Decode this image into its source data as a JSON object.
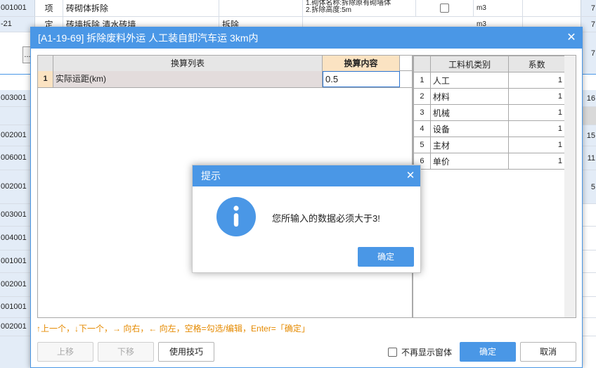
{
  "background": {
    "rows": [
      {
        "code": "001001",
        "type": "项",
        "name": "砖砌体拆除",
        "feature": "1.砌体名称:拆除原有砌墙体\n2.拆除高度:5m",
        "unit": "m3",
        "num": "7"
      },
      {
        "code": "-21",
        "type": "定",
        "name": "砖墙拆除 清水砖墙",
        "category": "拆除",
        "unit": "m3",
        "num": "7"
      },
      {
        "code": "",
        "num": "7"
      },
      {
        "code": "003001",
        "num": "16"
      },
      {
        "code": "002001",
        "num": "15"
      },
      {
        "code": "006001",
        "num": "11"
      },
      {
        "code": "002001",
        "num": "5"
      },
      {
        "code": "003001",
        "num": ""
      },
      {
        "code": "004001",
        "num": ""
      },
      {
        "code": "001001",
        "num": ""
      },
      {
        "code": "002001",
        "num": ""
      },
      {
        "code": "001001",
        "num": ""
      },
      {
        "code": "002001",
        "num": ""
      }
    ],
    "dots_label": "..."
  },
  "dialog": {
    "title": "[A1-19-69] 拆除废料外运 人工装自卸汽车运 3km内",
    "close_glyph": "✕",
    "left_table": {
      "col_list": "换算列表",
      "col_content": "换算内容",
      "rows": [
        {
          "num": "1",
          "name": "实际运距(km)",
          "value": "0.5"
        }
      ]
    },
    "right_table": {
      "col_type": "工料机类别",
      "col_coef": "系数",
      "rows": [
        {
          "num": "1",
          "type": "人工",
          "coef": "1"
        },
        {
          "num": "2",
          "type": "材料",
          "coef": "1"
        },
        {
          "num": "3",
          "type": "机械",
          "coef": "1"
        },
        {
          "num": "4",
          "type": "设备",
          "coef": "1"
        },
        {
          "num": "5",
          "type": "主材",
          "coef": "1"
        },
        {
          "num": "6",
          "type": "单价",
          "coef": "1"
        }
      ]
    },
    "hint": "↑上一个，↓下一个，→ 向右，← 向左，空格=勾选/编辑，Enter=「确定」",
    "buttons": {
      "up": "上移",
      "down": "下移",
      "tips": "使用技巧",
      "no_show": "不再显示窗体",
      "ok": "确定",
      "cancel": "取消"
    }
  },
  "alert": {
    "title": "提示",
    "close_glyph": "✕",
    "icon": "info-icon",
    "message": "您所输入的数据必须大于3!",
    "ok": "确定"
  },
  "colors": {
    "accent": "#4a97e6",
    "hint": "#e58a00",
    "header_highlight": "#fbe3c2"
  }
}
